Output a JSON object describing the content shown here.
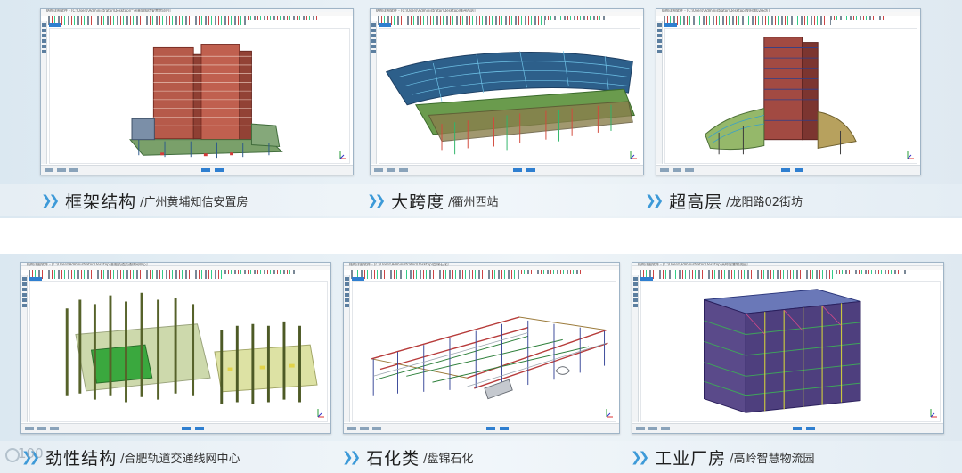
{
  "panels": [
    {
      "titlebar": "结构详图软件 - [C:\\Users\\Administrator\\Desktop\\广州黄埔知信安置房项目]",
      "title": "框架结构",
      "subtitle": "/广州黄埔知信安置房"
    },
    {
      "titlebar": "结构详图软件 - [C:\\Users\\Administrator\\Desktop\\衢州西站]",
      "title": "大跨度",
      "subtitle": "/衢州西站"
    },
    {
      "titlebar": "结构详图软件 - [C:\\Users\\Administrator\\Desktop\\龙阳路02街坊]",
      "title": "超高层",
      "subtitle": "/龙阳路02街坊"
    },
    {
      "titlebar": "结构详图软件 - [C:\\Users\\Administrator\\Desktop\\合肥轨道交通线网中心]",
      "title": "劲性结构",
      "subtitle": "/合肥轨道交通线网中心"
    },
    {
      "titlebar": "结构详图软件 - [C:\\Users\\Administrator\\Desktop\\盘锦石化]",
      "title": "石化类",
      "subtitle": "/盘锦石化"
    },
    {
      "titlebar": "结构详图软件 - [C:\\Users\\Administrator\\Desktop\\高岭智慧物流园]",
      "title": "工业厂房",
      "subtitle": "/高岭智慧物流园"
    }
  ],
  "watermark": "100",
  "colors": {
    "chevron": "#3d9ad8",
    "caption_band": "#e8f0f6",
    "background_band": "#dbe8f1"
  },
  "icons": {
    "chevron": "double-chevron-right-icon",
    "axis": "xyz-axis-icon"
  }
}
